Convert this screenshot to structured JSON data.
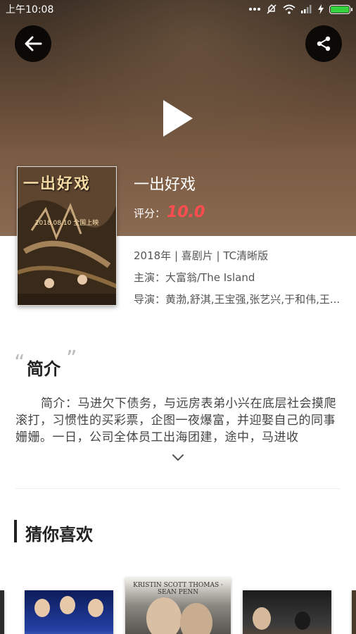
{
  "status_bar": {
    "time": "上午10:08"
  },
  "movie": {
    "title": "一出好戏",
    "rating_label": "评分：",
    "rating_value": "10.0",
    "genre_line": "2018年 | 喜剧片 | TC清晰版",
    "cast_line": "主演：大富翁/The Island",
    "director_line": "导演：黄渤,舒淇,王宝强,张艺兴,于和伟,王..."
  },
  "poster": {
    "title": "一出好戏",
    "date": "2018.08.10 全国上映"
  },
  "synopsis": {
    "quote_open": "“",
    "quote_close": "”",
    "heading": "简介",
    "text": "简介：马进欠下债务，与远房表弟小兴在底层社会摸爬滚打，习惯性的买彩票，企图一夜爆富，并迎娶自己的同事姗姗。一日，公司全体员工出海团建，途中，马进收"
  },
  "recommendations": {
    "heading": "猜你喜欢",
    "items": [
      {
        "caption": ""
      },
      {
        "caption": ""
      },
      {
        "caption": "KRISTIN SCOTT THOMAS · SEAN PENN"
      },
      {
        "caption": ""
      },
      {
        "caption": ""
      }
    ]
  },
  "colors": {
    "accent_rating": "#ff4d4f",
    "battery": "#36d13f"
  },
  "icons": [
    "back-arrow-icon",
    "share-icon",
    "play-icon",
    "chevron-down-icon",
    "wifi-icon",
    "signal-icon",
    "battery-icon",
    "more-dots-icon",
    "mute-icon",
    "charging-icon"
  ]
}
